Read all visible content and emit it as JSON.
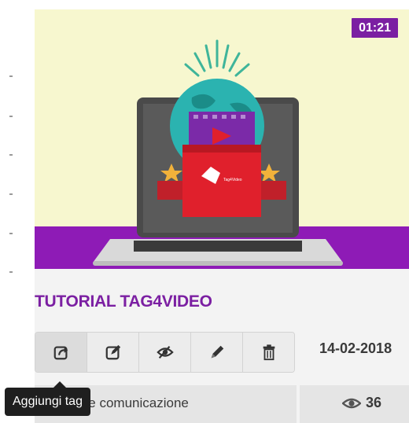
{
  "video": {
    "duration": "01:21",
    "title": "TUTORIAL TAG4VIDEO",
    "date": "14-02-2018",
    "category": "...mio e comunicazione",
    "views": "36",
    "thumbnail_logo_text": "Tag4Video"
  },
  "toolbar": {
    "buttons": [
      {
        "icon": "share-arrow-icon",
        "active": true
      },
      {
        "icon": "edit-box-icon"
      },
      {
        "icon": "hide-eye-icon"
      },
      {
        "icon": "pencil-icon"
      },
      {
        "icon": "trash-icon"
      }
    ]
  },
  "tooltip": {
    "text": "Aggiungi tag"
  },
  "colors": {
    "accent": "#7b1fa2",
    "thumb_bg": "#f7f7cf",
    "band": "#8e1bb6",
    "globe": "#2bb3b0",
    "red": "#e0202c"
  }
}
